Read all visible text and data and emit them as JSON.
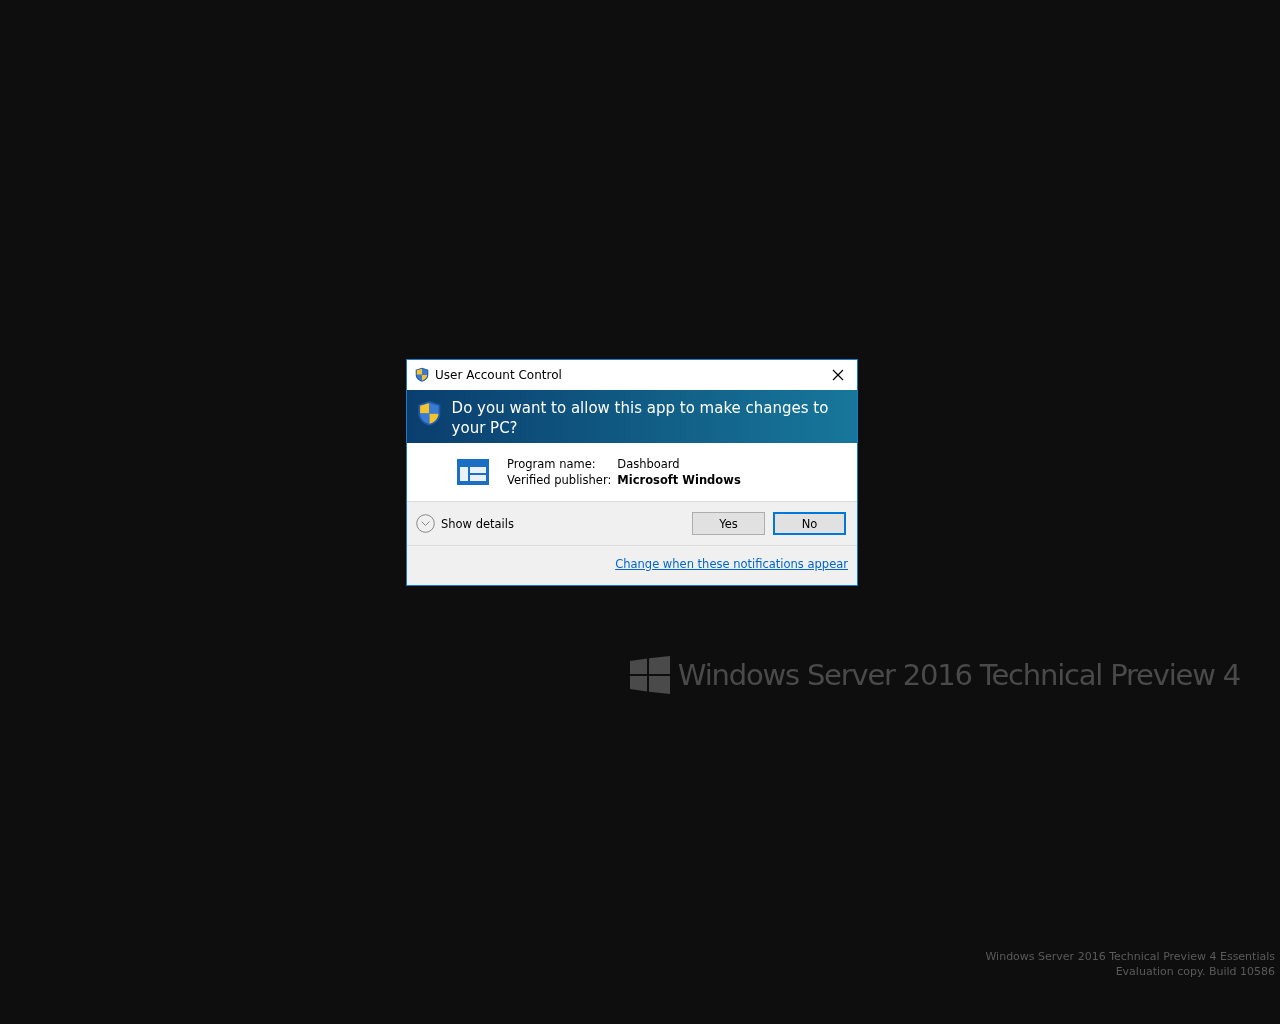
{
  "dialog": {
    "title": "User Account Control",
    "question": "Do you want to allow this app to make changes to your PC?",
    "fields": [
      {
        "label": "Program name:",
        "value": "Dashboard",
        "bold": false
      },
      {
        "label": "Verified publisher:",
        "value": "Microsoft Windows",
        "bold": true
      }
    ],
    "details_toggle": {
      "label": "Show details",
      "expanded": false
    },
    "buttons": [
      {
        "label": "Yes",
        "focused": false
      },
      {
        "label": "No",
        "focused": true
      }
    ],
    "link": "Change when these notifications appear"
  },
  "branding": {
    "product": "Windows Server 2016 Technical Preview 4"
  },
  "watermark_lines": [
    "Windows Server 2016 Technical Preview 4 Essentials",
    "Evaluation copy. Build 10586"
  ]
}
